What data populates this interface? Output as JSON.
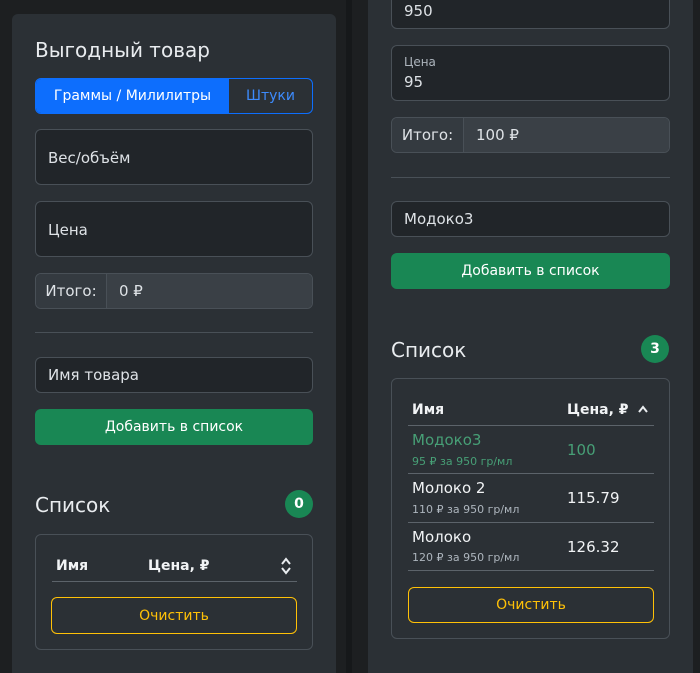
{
  "left": {
    "title": "Выгодный товар",
    "mode_tabs": [
      "Граммы / Милилитры",
      "Штуки"
    ],
    "weight_placeholder": "Вес/объём",
    "price_placeholder": "Цена",
    "total_label": "Итого:",
    "total_value": "0 ₽",
    "name_placeholder": "Имя товара",
    "add_button": "Добавить в список",
    "list_title": "Список",
    "list_count": "0",
    "col_name": "Имя",
    "col_price": "Цена, ₽",
    "clear_button": "Очистить"
  },
  "right": {
    "weight_value": "950",
    "price_label": "Цена",
    "price_value": "95",
    "total_label": "Итого:",
    "total_value": "100 ₽",
    "name_value": "Модоко3",
    "add_button": "Добавить в список",
    "list_title": "Список",
    "list_count": "3",
    "col_name": "Имя",
    "col_price": "Цена, ₽",
    "items": [
      {
        "name": "Модоко3",
        "detail": "95 ₽ за 950 гр/мл",
        "price": "100",
        "best": true
      },
      {
        "name": "Молоко 2",
        "detail": "110 ₽ за 950 гр/мл",
        "price": "115.79",
        "best": false
      },
      {
        "name": "Молоко",
        "detail": "120 ₽ за 950 гр/мл",
        "price": "126.32",
        "best": false
      }
    ],
    "clear_button": "Очистить"
  },
  "colors": {
    "primary": "#0d6efd",
    "success": "#198754",
    "warning": "#ffc107",
    "best_item": "#479f76"
  }
}
